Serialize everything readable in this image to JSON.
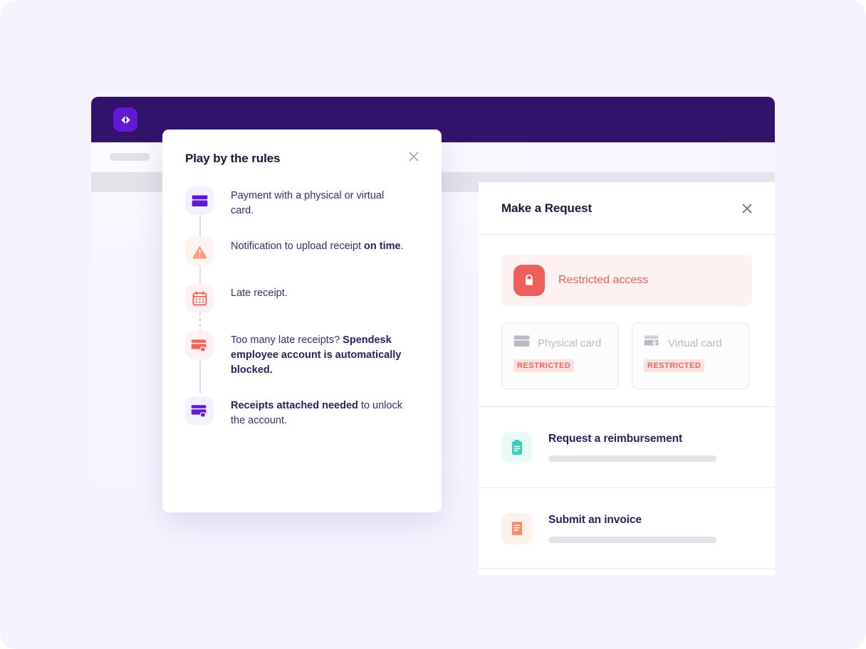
{
  "app": {
    "logo_icon": "spendesk-chevron-logo",
    "toolbar_skeleton": "loading-pill"
  },
  "modal": {
    "title": "Play by the rules",
    "close_icon": "close-icon",
    "steps": [
      {
        "icon": "credit-card-icon",
        "icon_style": "lilac",
        "text_prefix": "Payment with a physical or virtual card.",
        "text_bold": "",
        "text_suffix": ""
      },
      {
        "icon": "warning-triangle-icon",
        "icon_style": "peach",
        "text_prefix": "Notification to upload receipt ",
        "text_bold": "on time",
        "text_suffix": "."
      },
      {
        "icon": "calendar-icon",
        "icon_style": "blush",
        "text_prefix": "Late receipt.",
        "text_bold": "",
        "text_suffix": ""
      },
      {
        "icon": "card-locked-icon",
        "icon_style": "blush",
        "text_prefix": "Too many late receipts? ",
        "text_bold": "Spendesk employee account is automatically blocked.",
        "text_suffix": ""
      },
      {
        "icon": "card-unlocked-icon",
        "icon_style": "lilac",
        "text_prefix": "",
        "text_bold": "Receipts attached needed",
        "text_suffix": " to unlock the account."
      }
    ]
  },
  "panel": {
    "title": "Make a Request",
    "close_icon": "close-icon",
    "restricted_banner": {
      "icon": "lock-icon",
      "label": "Restricted access"
    },
    "card_options": [
      {
        "icon": "credit-card-icon",
        "label": "Physical card",
        "badge": "RESTRICTED"
      },
      {
        "icon": "virtual-card-bolt-icon",
        "label": "Virtual card",
        "badge": "RESTRICTED"
      }
    ],
    "actions": [
      {
        "icon": "clipboard-icon",
        "icon_style": "teal",
        "label": "Request a reimbursement"
      },
      {
        "icon": "receipt-icon",
        "icon_style": "peach",
        "label": "Submit an invoice"
      }
    ]
  },
  "colors": {
    "page_background": "#f6f3ff",
    "header_purple": "#32136c",
    "brand_purple": "#6219d6",
    "accent_red": "#ec5f5a",
    "accent_teal": "#2fd3bd",
    "accent_coral": "#f58a6a",
    "text_dark": "#1b1638",
    "text_body": "#3b2b6e",
    "muted_grey": "#b9b8c4"
  }
}
